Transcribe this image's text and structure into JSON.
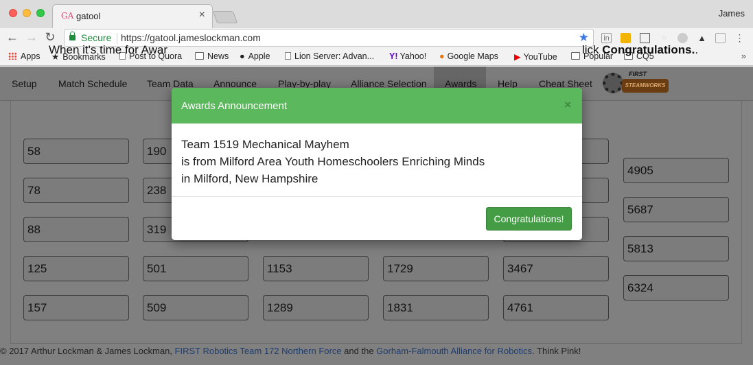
{
  "browser": {
    "tab_icon": "GA",
    "tab_title": "gatool",
    "tab_close": "×",
    "user": "James",
    "secure_label": "Secure",
    "url": "https://gatool.jameslockman.com",
    "bookmarks": [
      {
        "label": "Apps",
        "icon": "apps-icon"
      },
      {
        "label": "Bookmarks",
        "icon": "star-icon"
      },
      {
        "label": "Post to Quora",
        "icon": "doc-icon"
      },
      {
        "label": "News",
        "icon": "folder-icon"
      },
      {
        "label": "Apple",
        "icon": "apple-icon"
      },
      {
        "label": "Lion Server: Advan...",
        "icon": "apple-doc-icon"
      },
      {
        "label": "Yahoo!",
        "icon": "yahoo-icon"
      },
      {
        "label": "Google Maps",
        "icon": "maps-icon"
      },
      {
        "label": "YouTube",
        "icon": "youtube-icon"
      },
      {
        "label": "Popular",
        "icon": "folder-icon"
      },
      {
        "label": "CQ5",
        "icon": "folder-icon"
      }
    ],
    "bookmarks_more": "»"
  },
  "nav": {
    "items": [
      "Setup",
      "Match Schedule",
      "Team Data",
      "Announce",
      "Play-by-play",
      "Alliance Selection",
      "Awards",
      "Help",
      "Cheat Sheet"
    ],
    "active": "Awards",
    "logo_top": "FIRST",
    "logo_bottom": "STEAMWORKS"
  },
  "page": {
    "instruction_left": "When it's time for Awar",
    "instruction_right_prefix": "lick ",
    "instruction_right_bold": "Congratulations.",
    "instruction_right_suffix": "."
  },
  "teams": {
    "col1": [
      "58",
      "78",
      "88",
      "125",
      "157"
    ],
    "col2": [
      "190",
      "238",
      "319",
      "501",
      "509"
    ],
    "col3": [
      "1153",
      "1289"
    ],
    "col4": [
      "1729",
      "1831"
    ],
    "col5": [
      "3467",
      "4761"
    ],
    "col6": [
      "4905",
      "5687",
      "5813",
      "6324"
    ]
  },
  "footer": {
    "prefix": "© 2017 Arthur Lockman & James Lockman, ",
    "link1": "FIRST Robotics Team 172 Northern Force",
    "middle": " and the ",
    "link2": "Gorham-Falmouth Alliance for Robotics",
    "suffix": ". Think Pink!"
  },
  "modal": {
    "title": "Awards Announcement",
    "close": "×",
    "line1": "Team 1519 Mechanical Mayhem",
    "line2": "is from Milford Area Youth Homeschoolers Enriching Minds",
    "line3": "in Milford, New Hampshire",
    "button": "Congratulations!"
  },
  "colors": {
    "modal_header": "#5cb85c",
    "button": "#449d44",
    "overlay_page": "#808080"
  }
}
